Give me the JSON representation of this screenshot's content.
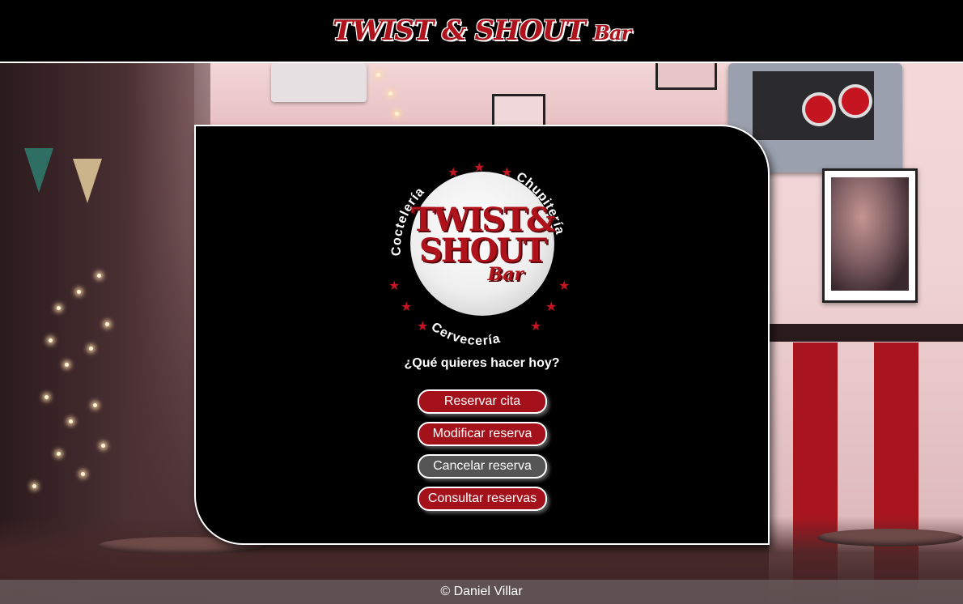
{
  "header": {
    "logo_main": "TWIST & SHOUT",
    "logo_suffix": "Bar"
  },
  "emblem": {
    "line1": "TWIST&",
    "line2": "SHOUT",
    "line3": "Bar",
    "arc_left": "Coctelería",
    "arc_right": "Chupitería",
    "arc_bottom": "Cervecería"
  },
  "main": {
    "question": "¿Qué quieres hacer hoy?",
    "buttons": [
      {
        "label": "Reservar cita",
        "color": "#a4111a"
      },
      {
        "label": "Modificar reserva",
        "color": "#a4111a"
      },
      {
        "label": "Cancelar reserva",
        "color": "#555555"
      },
      {
        "label": "Consultar reservas",
        "color": "#a4111a"
      }
    ]
  },
  "footer": {
    "copyright": "© Daniel Villar"
  },
  "colors": {
    "brand_red": "#b0121b",
    "panel_bg": "#000000"
  }
}
